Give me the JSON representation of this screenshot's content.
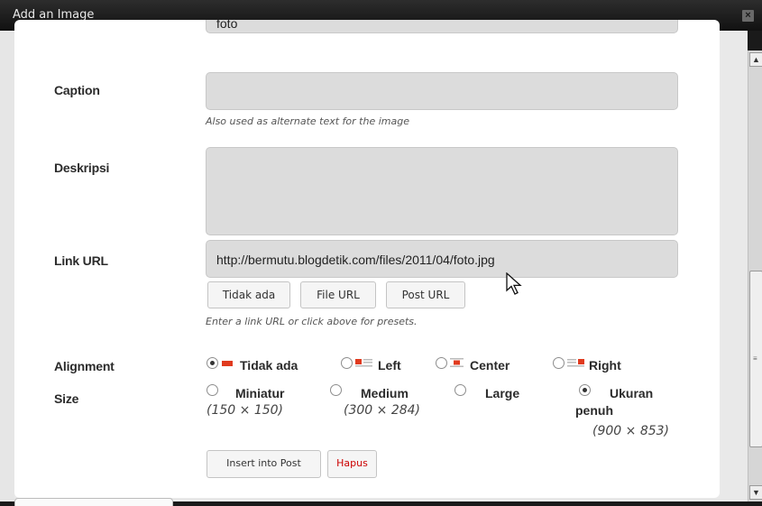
{
  "dialog": {
    "title": "Add an Image",
    "close_icon": "close-icon"
  },
  "form": {
    "judul": {
      "value": "foto"
    },
    "caption": {
      "label": "Caption",
      "value": "",
      "hint": "Also used as alternate text for the image"
    },
    "deskripsi": {
      "label": "Deskripsi",
      "value": ""
    },
    "link_url": {
      "label": "Link URL",
      "value": "http://bermutu.blogdetik.com/files/2011/04/foto.jpg",
      "buttons": [
        "Tidak ada",
        "File URL",
        "Post URL"
      ],
      "hint": "Enter a link URL or click above for presets."
    },
    "alignment": {
      "label": "Alignment",
      "options": [
        "Tidak ada",
        "Left",
        "Center",
        "Right"
      ],
      "selected": "Tidak ada",
      "accent": "#e03a1e"
    },
    "size": {
      "label": "Size",
      "options": [
        {
          "name": "Miniatur",
          "dims": "(150 × 150)"
        },
        {
          "name": "Medium",
          "dims": "(300 × 284)"
        },
        {
          "name": "Large",
          "dims": ""
        },
        {
          "name_line1": "Ukuran",
          "name_line2": "penuh",
          "dims": "(900 × 853)"
        }
      ],
      "selected": "Ukuran penuh"
    },
    "actions": {
      "insert": "Insert into Post",
      "delete": "Hapus",
      "delete_color": "#cc0000"
    }
  }
}
